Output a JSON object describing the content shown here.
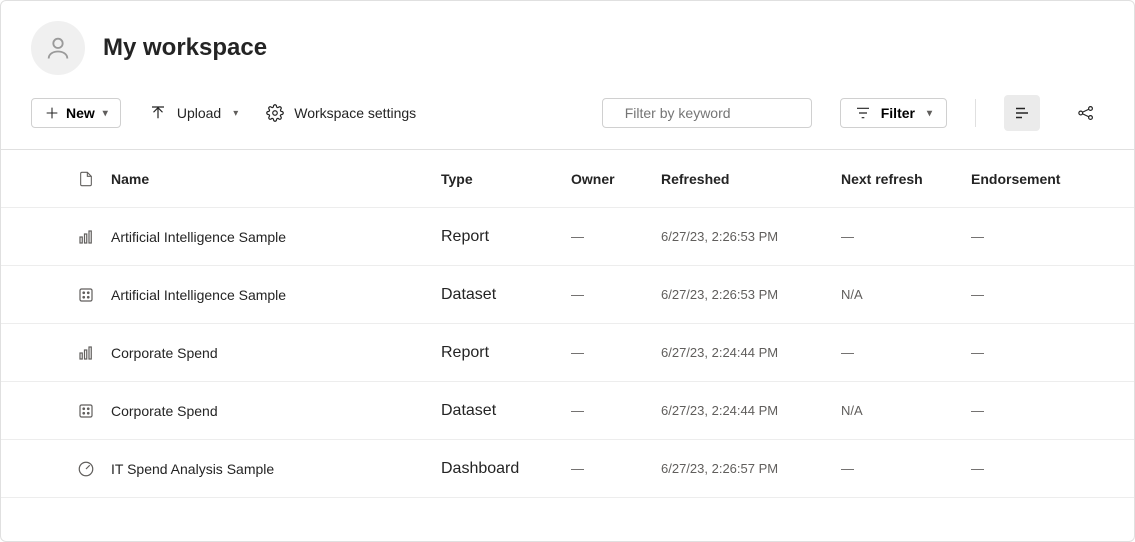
{
  "header": {
    "title": "My workspace"
  },
  "toolbar": {
    "new_label": "New",
    "upload_label": "Upload",
    "settings_label": "Workspace settings",
    "search_placeholder": "Filter by keyword",
    "filter_label": "Filter"
  },
  "columns": {
    "name": "Name",
    "type": "Type",
    "owner": "Owner",
    "refreshed": "Refreshed",
    "next_refresh": "Next refresh",
    "endorsement": "Endorsement"
  },
  "items": [
    {
      "icon": "report",
      "name": "Artificial Intelligence Sample",
      "type": "Report",
      "owner": "—",
      "refreshed": "6/27/23, 2:26:53 PM",
      "next_refresh": "—",
      "endorsement": "—"
    },
    {
      "icon": "dataset",
      "name": "Artificial Intelligence Sample",
      "type": "Dataset",
      "owner": "—",
      "refreshed": "6/27/23, 2:26:53 PM",
      "next_refresh": "N/A",
      "endorsement": "—"
    },
    {
      "icon": "report",
      "name": "Corporate Spend",
      "type": "Report",
      "owner": "—",
      "refreshed": "6/27/23, 2:24:44 PM",
      "next_refresh": "—",
      "endorsement": "—"
    },
    {
      "icon": "dataset",
      "name": "Corporate Spend",
      "type": "Dataset",
      "owner": "—",
      "refreshed": "6/27/23, 2:24:44 PM",
      "next_refresh": "N/A",
      "endorsement": "—"
    },
    {
      "icon": "dashboard",
      "name": "IT Spend Analysis Sample",
      "type": "Dashboard",
      "owner": "—",
      "refreshed": "6/27/23, 2:26:57 PM",
      "next_refresh": "—",
      "endorsement": "—"
    }
  ]
}
